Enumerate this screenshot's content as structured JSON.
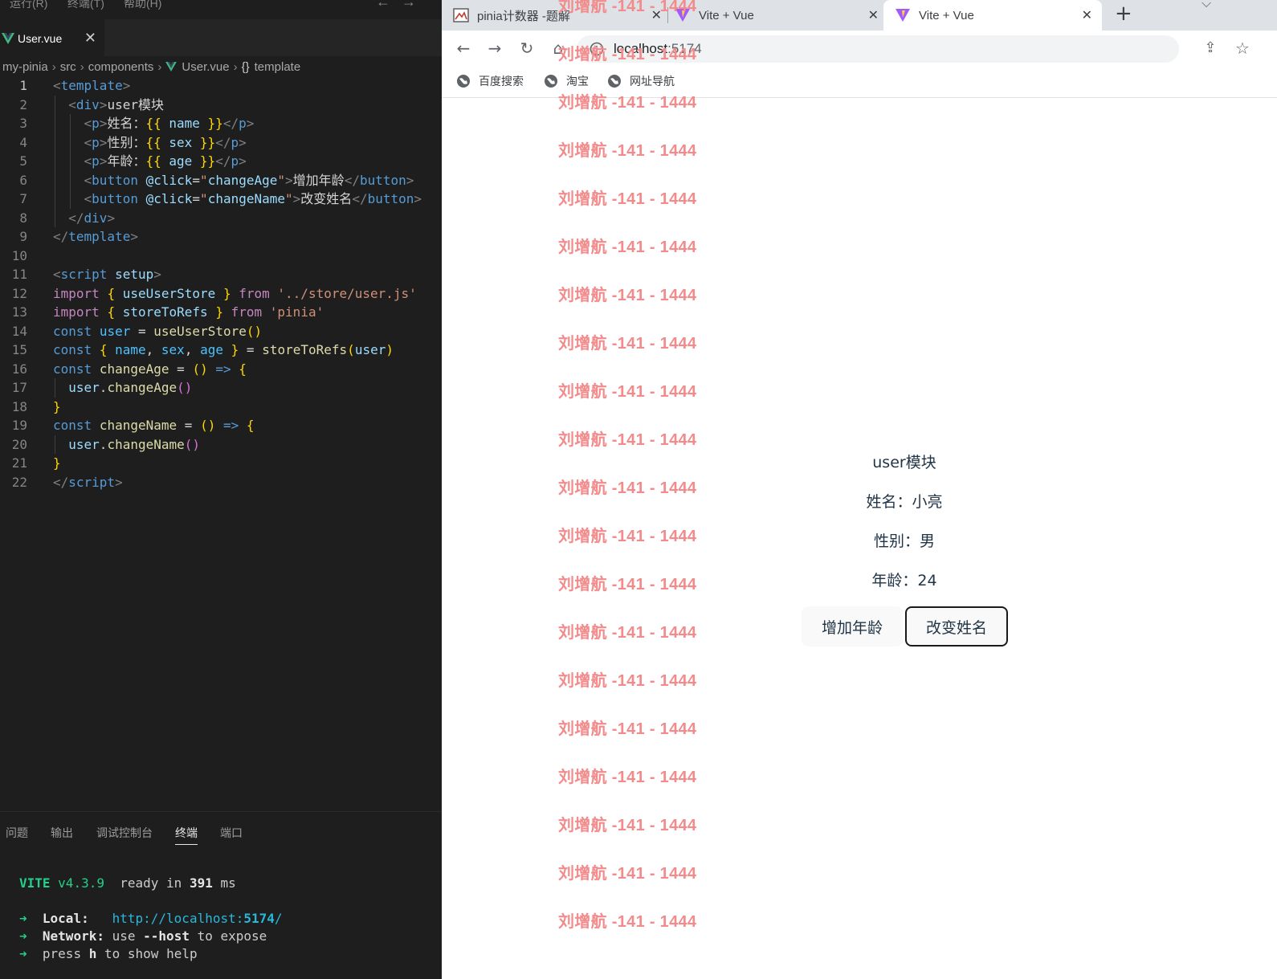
{
  "vscode": {
    "menu": [
      "运行(R)",
      "终端(T)",
      "帮助(H)"
    ],
    "tab": {
      "label": "User.vue"
    },
    "breadcrumb": [
      "my-pinia",
      "src",
      "components",
      "User.vue",
      "template"
    ],
    "panel_tabs": [
      "问题",
      "输出",
      "调试控制台",
      "终端",
      "端口"
    ],
    "active_panel_tab": "终端",
    "terminal": {
      "vite": "VITE",
      "version": "v4.3.9",
      "ready": "ready in",
      "ready_ms": "391",
      "ms": "ms",
      "local_label": "Local:",
      "local_url_prefix": "http://localhost:",
      "local_port": "5174",
      "local_url_suffix": "/",
      "network_label": "Network:",
      "network_use": "use",
      "network_flag": "--host",
      "network_rest": "to expose",
      "help_press": "press",
      "help_key": "h",
      "help_rest": "to show help"
    }
  },
  "browser": {
    "tabs": [
      {
        "title": "pinia计数器 -题解",
        "active": false
      },
      {
        "title": "Vite + Vue",
        "active": false
      },
      {
        "title": "Vite + Vue",
        "active": true
      }
    ],
    "url_host": "localhost",
    "url_port": ":5174",
    "bookmarks": [
      "百度搜索",
      "淘宝",
      "网址导航"
    ],
    "watermark": "刘增航 -141 - 1444",
    "app": {
      "heading": "user模块",
      "name_line": "姓名：小亮",
      "sex_line": "性别：男",
      "age_line": "年龄：24",
      "btn_age": "增加年龄",
      "btn_name": "改变姓名"
    }
  },
  "colors": {
    "vscode_bg": "#1e1e1e",
    "watermark": "#f28b8b",
    "vite_green": "#23d18b",
    "url_cyan": "#29b8db"
  }
}
